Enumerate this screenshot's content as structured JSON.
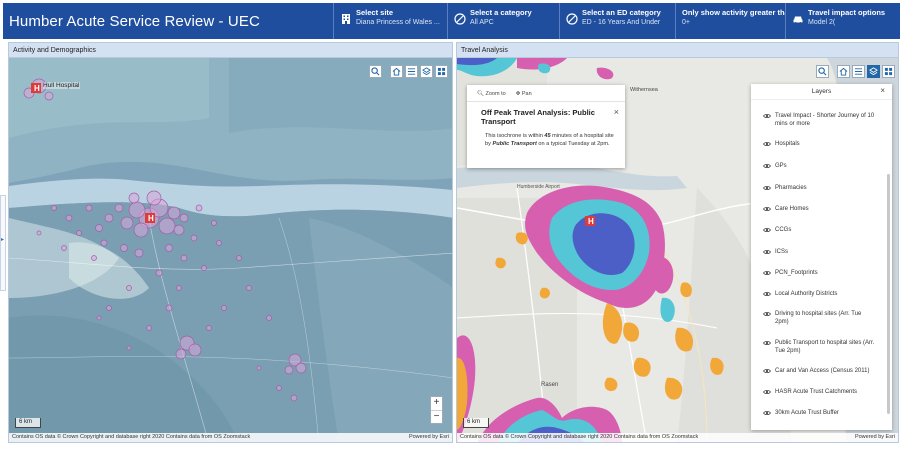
{
  "header": {
    "title": "Humber Acute Service Review - UEC",
    "items": [
      {
        "label": "Select site",
        "value": "Diana Princess of Wales ...",
        "icon": "building-icon"
      },
      {
        "label": "Select a category",
        "value": "All APC",
        "icon": "category-icon"
      },
      {
        "label": "Select an ED category",
        "value": "ED - 16 Years And Under",
        "icon": "category-icon"
      },
      {
        "label": "Only show activity greater than",
        "value": "0+"
      },
      {
        "label": "Travel impact options",
        "value": "Model 2(",
        "icon": "car-icon"
      }
    ]
  },
  "left_panel": {
    "title": "Activity and Demographics",
    "map_label": "Hull Hospital",
    "scale_label": "6 km",
    "attribution": "Contains OS data © Crown Copyright and database right 2020 Contains data from OS Zoomstack",
    "powered_by": "Powered by Esri",
    "zoom_in": "+",
    "zoom_out": "−"
  },
  "right_panel": {
    "title": "Travel Analysis",
    "scale_label": "6 km",
    "attribution": "Contains OS data © Crown Copyright and database right 2020 Contains data from OS Zoomstack",
    "powered_by": "Powered by Esri",
    "map_labels": [
      "Withernsea",
      "Humberside Airport",
      "Rasen"
    ],
    "popup": {
      "zoom_to": "Zoom to",
      "pan": "Pan",
      "title": "Off Peak Travel Analysis: Public Transport",
      "body_1": "This isochrone is within ",
      "body_minutes": "45",
      "body_2": " minutes of a hospital site by ",
      "body_mode": "Public Transport",
      "body_3": " on a typical Tuesday at 2pm.",
      "close": "×"
    },
    "layers": {
      "title": "Layers",
      "close": "×",
      "items": [
        "Travel Impact - Shorter Journey of 10 mins or more",
        "Hospitals",
        "GPs",
        "Pharmacies",
        "Care Homes",
        "CCGs",
        "ICSs",
        "PCN_Footprints",
        "Local Authority Districts",
        "Driving to hospital sites (Arr. Tue 2pm)",
        "Public Transport to hospital sites (Arr. Tue 2pm)",
        "Car and Van Access (Census 2011)",
        "HASR Acute Trust Catchments",
        "30km Acute Trust Buffer"
      ]
    }
  },
  "colors": {
    "header": "#1f4e9e",
    "accent": "#2367a7",
    "estuary": "#b3cde0",
    "hospital": "#e03b3b",
    "isochrone_blue": "#4b5fc7",
    "isochrone_cyan": "#55c6d6",
    "isochrone_pink": "#d65fb0",
    "isochrone_orange": "#f2a838"
  }
}
